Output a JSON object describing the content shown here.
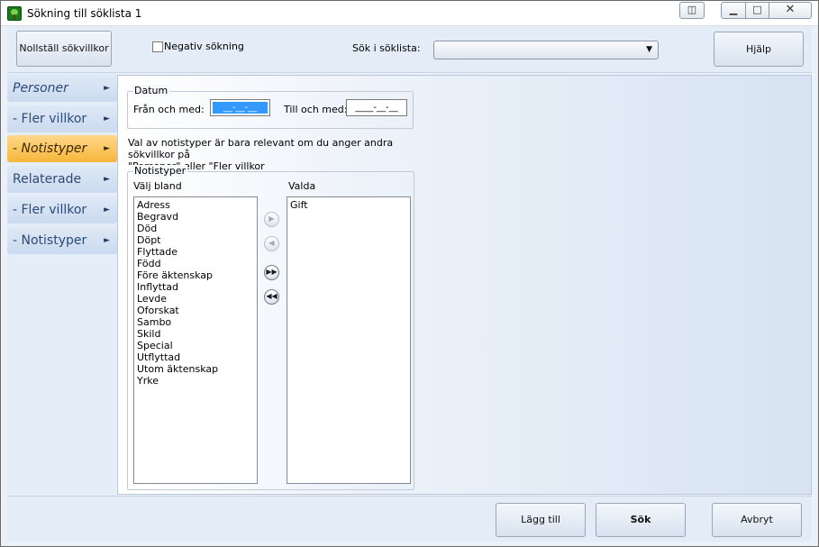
{
  "window": {
    "title": "Sökning till söklista 1",
    "controls": {
      "restore": "◫",
      "minimize": "▁",
      "maximize": "□",
      "close": "✕"
    }
  },
  "toolbar": {
    "reset_label": "Nollställ sökvillkor",
    "negative_label": "Negativ sökning",
    "negative_checked": false,
    "search_list_label": "Sök i söklista:",
    "search_list_value": "",
    "help_label": "Hjälp"
  },
  "sidebar": {
    "items": [
      {
        "label": "Personer",
        "italic": true,
        "active": false
      },
      {
        "label": "- Fler villkor",
        "italic": false,
        "active": false
      },
      {
        "label": "- Notistyper",
        "italic": true,
        "active": true
      },
      {
        "label": "Relaterade",
        "italic": false,
        "active": false
      },
      {
        "label": "- Fler villkor",
        "italic": false,
        "active": false
      },
      {
        "label": "- Notistyper",
        "italic": false,
        "active": false
      }
    ],
    "caret": "►"
  },
  "datum": {
    "title": "Datum",
    "from_label": "Från och med:",
    "from_value": "__-__-__",
    "to_label": "Till och med:",
    "to_value": "____-__-__"
  },
  "info": {
    "line1": "Val av notistyper är bara relevant om du anger andra sökvillkor på",
    "line2": "\"Personer\" eller \"Fler villkor"
  },
  "notistyper": {
    "title": "Notistyper",
    "available_label": "Välj bland",
    "selected_label": "Valda",
    "available": [
      "Adress",
      "Begravd",
      "Död",
      "Döpt",
      "Flyttade",
      "Född",
      "Före äktenskap",
      "Inflyttad",
      "Levde",
      "Oforskat",
      "Sambo",
      "Skild",
      "Special",
      "Utflyttad",
      "Utom äktenskap",
      "Yrke"
    ],
    "selected": [
      "Gift"
    ],
    "buttons": {
      "add_one": "▶",
      "remove_one": "◀",
      "add_all": "▶▶",
      "remove_all": "◀◀"
    }
  },
  "footer": {
    "add_label": "Lägg till",
    "search_label": "Sök",
    "cancel_label": "Avbryt"
  }
}
